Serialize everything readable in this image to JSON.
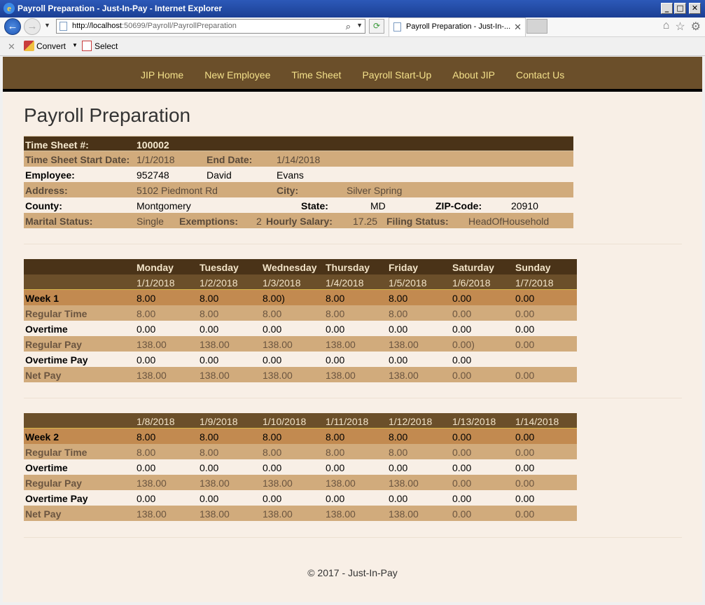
{
  "window": {
    "title": "Payroll Preparation - Just-In-Pay - Internet Explorer",
    "url_host": "http://localhost",
    "url_rest": ":50699/Payroll/PayrollPreparation",
    "tab_title": "Payroll Preparation - Just-In-..."
  },
  "commandbar": {
    "convert": "Convert",
    "select": "Select"
  },
  "nav": {
    "links": [
      "JIP Home",
      "New Employee",
      "Time Sheet",
      "Payroll Start-Up",
      "About JIP",
      "Contact Us"
    ]
  },
  "page": {
    "title": "Payroll Preparation"
  },
  "timesheet": {
    "number_label": "Time Sheet #:",
    "number": "100002",
    "start_label": "Time Sheet Start Date:",
    "start": "1/1/2018",
    "end_label": "End Date:",
    "end": "1/14/2018",
    "employee_label": "Employee:",
    "employee_no": "952748",
    "first_name": "David",
    "last_name": "Evans",
    "address_label": "Address:",
    "address": "5102 Piedmont Rd",
    "city_label": "City:",
    "city": "Silver Spring",
    "county_label": "County:",
    "county": "Montgomery",
    "state_label": "State:",
    "state": "MD",
    "zip_label": "ZIP-Code:",
    "zip": "20910",
    "marital_label": "Marital Status:",
    "marital": "Single",
    "exemptions_label": "Exemptions:",
    "exemptions": "2",
    "salary_label": "Hourly Salary:",
    "salary": "17.25",
    "filing_label": "Filing Status:",
    "filing": "HeadOfHousehold"
  },
  "days": [
    "Monday",
    "Tuesday",
    "Wednesday",
    "Thursday",
    "Friday",
    "Saturday",
    "Sunday"
  ],
  "week1": {
    "dates": [
      "1/1/2018",
      "1/2/2018",
      "1/3/2018",
      "1/4/2018",
      "1/5/2018",
      "1/6/2018",
      "1/7/2018"
    ],
    "rows": [
      {
        "label": "Week 1",
        "values": [
          "8.00",
          "8.00",
          "8.00)",
          "8.00",
          "8.00",
          "0.00",
          "0.00"
        ]
      },
      {
        "label": "Regular Time",
        "values": [
          "8.00",
          "8.00",
          "8.00",
          "8.00",
          "8.00",
          "0.00",
          "0.00"
        ]
      },
      {
        "label": "Overtime",
        "values": [
          "0.00",
          "0.00",
          "0.00",
          "0.00",
          "0.00",
          "0.00",
          "0.00"
        ]
      },
      {
        "label": "Regular Pay",
        "values": [
          "138.00",
          "138.00",
          "138.00",
          "138.00",
          "138.00",
          "0.00)",
          "0.00"
        ]
      },
      {
        "label": "Overtime Pay",
        "values": [
          "0.00",
          "0.00",
          "0.00",
          "0.00",
          "0.00",
          "0.00",
          ""
        ]
      },
      {
        "label": "Net Pay",
        "values": [
          "138.00",
          "138.00",
          "138.00",
          "138.00",
          "138.00",
          "0.00",
          "0.00"
        ]
      }
    ]
  },
  "week2": {
    "dates": [
      "1/8/2018",
      "1/9/2018",
      "1/10/2018",
      "1/11/2018",
      "1/12/2018",
      "1/13/2018",
      "1/14/2018"
    ],
    "rows": [
      {
        "label": "Week 2",
        "values": [
          "8.00",
          "8.00",
          "8.00",
          "8.00",
          "8.00",
          "0.00",
          "0.00"
        ]
      },
      {
        "label": "Regular Time",
        "values": [
          "8.00",
          "8.00",
          "8.00",
          "8.00",
          "8.00",
          "0.00",
          "0.00"
        ]
      },
      {
        "label": "Overtime",
        "values": [
          "0.00",
          "0.00",
          "0.00",
          "0.00",
          "0.00",
          "0.00",
          "0.00"
        ]
      },
      {
        "label": "Regular Pay",
        "values": [
          "138.00",
          "138.00",
          "138.00",
          "138.00",
          "138.00",
          "0.00",
          "0.00"
        ]
      },
      {
        "label": "Overtime Pay",
        "values": [
          "0.00",
          "0.00",
          "0.00",
          "0.00",
          "0.00",
          "0.00",
          "0.00"
        ]
      },
      {
        "label": "Net Pay",
        "values": [
          "138.00",
          "138.00",
          "138.00",
          "138.00",
          "138.00",
          "0.00",
          "0.00"
        ]
      }
    ]
  },
  "footer": {
    "text": "© 2017 - Just-In-Pay"
  }
}
